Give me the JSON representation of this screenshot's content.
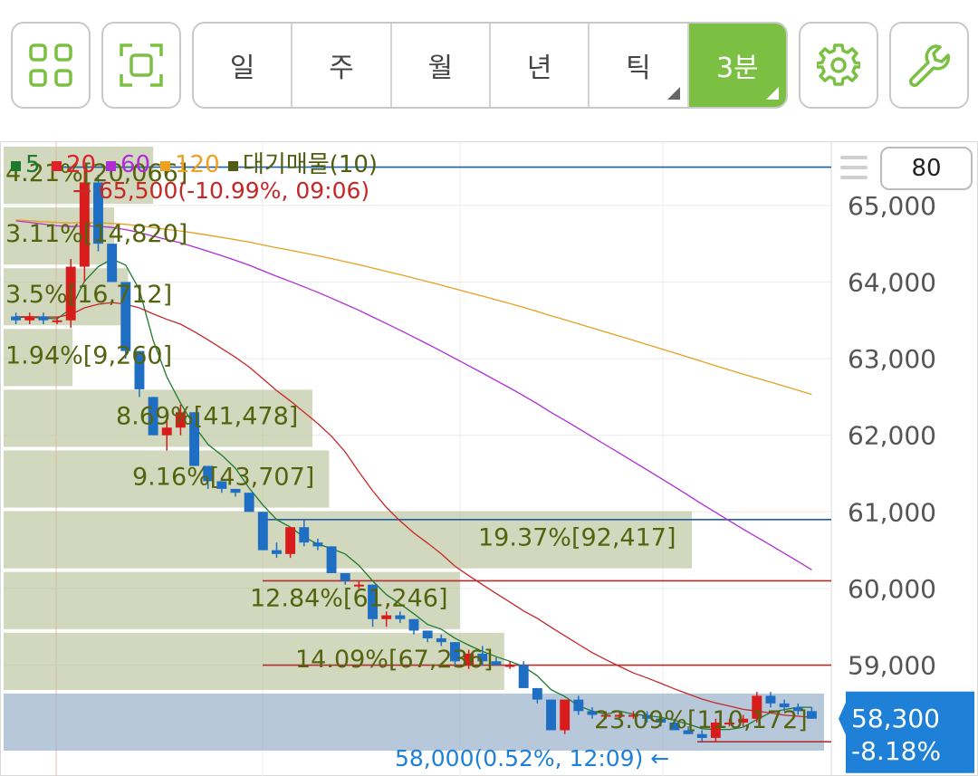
{
  "toolbar": {
    "grid_icon": "grid-icon",
    "fullscreen_icon": "fullscreen-icon",
    "periods": [
      "일",
      "주",
      "월",
      "년",
      "틱",
      "3분"
    ],
    "active_period": "3분",
    "settings_icon": "gear-icon",
    "tools_icon": "wrench-icon"
  },
  "count_input": {
    "value": "80"
  },
  "colors": {
    "accent": "#7bc043",
    "up": "#d81b1b",
    "down": "#1e6fc4",
    "ma5": "#1c7a2e",
    "ma20": "#c62828",
    "ma60": "#b02dd6",
    "ma120": "#e6a020",
    "volume_profile": "#5a6b11",
    "current_price_bg": "#1e80d6"
  },
  "chart_data": {
    "type": "candlestick",
    "legend": [
      {
        "label": "5",
        "color": "#1c7a2e"
      },
      {
        "label": "20",
        "color": "#e0202a"
      },
      {
        "label": "60",
        "color": "#b02dd6"
      },
      {
        "label": "120",
        "color": "#f0a020"
      },
      {
        "label": "대기매물(10)",
        "color": "#4f5e0e"
      }
    ],
    "y_ticks": [
      "65,000",
      "64,000",
      "63,000",
      "62,000",
      "61,000",
      "60,000",
      "59,000"
    ],
    "y_tick_values": [
      65000,
      64000,
      63000,
      62000,
      61000,
      60000,
      59000
    ],
    "ylim": [
      57860,
      65790
    ],
    "high_annotation": "65,500(-10.99%, 09:06)",
    "low_annotation": "58,000(0.52%, 12:09)",
    "current_price": "58,300",
    "current_change": "-8.18%",
    "volume_profile": [
      {
        "label": "4.21%[20,066]",
        "pct": 4.21
      },
      {
        "label": "3.11%[14,820]",
        "pct": 3.11
      },
      {
        "label": "3.5%[16,712]",
        "pct": 3.5
      },
      {
        "label": "1.94%[9,260]",
        "pct": 1.94
      },
      {
        "label": "8.69%[41,478]",
        "pct": 8.69
      },
      {
        "label": "9.16%[43,707]",
        "pct": 9.16
      },
      {
        "label": "19.37%[92,417]",
        "pct": 19.37
      },
      {
        "label": "12.84%[61,246]",
        "pct": 12.84
      },
      {
        "label": "14.09%[67,236]",
        "pct": 14.09
      },
      {
        "label": "23.09%[110,172]",
        "pct": 23.09
      }
    ],
    "horizontal_lines": [
      {
        "price": 65500,
        "color": "#1f5fa8"
      },
      {
        "price": 60900,
        "color": "#1f5fa8"
      },
      {
        "price": 60100,
        "color": "#b03030"
      },
      {
        "price": 59000,
        "color": "#b03030"
      },
      {
        "price": 58000,
        "color": "#b03030"
      }
    ],
    "candles": [
      [
        63550,
        63600,
        63450,
        63500
      ],
      [
        63500,
        63600,
        63450,
        63550
      ],
      [
        63550,
        63600,
        63450,
        63500
      ],
      [
        63500,
        63550,
        63450,
        63500
      ],
      [
        63500,
        64300,
        63400,
        64200
      ],
      [
        64200,
        65500,
        64000,
        65300
      ],
      [
        65300,
        65400,
        64400,
        64500
      ],
      [
        64500,
        64500,
        64000,
        64000
      ],
      [
        64000,
        64000,
        63000,
        63100
      ],
      [
        63100,
        63100,
        62500,
        62600
      ],
      [
        62500,
        62500,
        62000,
        62000
      ],
      [
        62000,
        62200,
        61800,
        62100
      ],
      [
        62100,
        62400,
        62000,
        62300
      ],
      [
        62300,
        62300,
        61600,
        61600
      ],
      [
        61600,
        61600,
        61300,
        61400
      ],
      [
        61400,
        61400,
        61250,
        61300
      ],
      [
        61300,
        61300,
        61200,
        61250
      ],
      [
        61250,
        61250,
        61000,
        61000
      ],
      [
        61000,
        61000,
        60500,
        60500
      ],
      [
        60500,
        60600,
        60400,
        60450
      ],
      [
        60450,
        60800,
        60400,
        60800
      ],
      [
        60800,
        60900,
        60550,
        60600
      ],
      [
        60600,
        60650,
        60500,
        60550
      ],
      [
        60550,
        60550,
        60200,
        60200
      ],
      [
        60200,
        60200,
        60050,
        60100
      ],
      [
        60050,
        60100,
        60000,
        60050
      ],
      [
        60050,
        60050,
        59500,
        59600
      ],
      [
        59600,
        59700,
        59500,
        59650
      ],
      [
        59650,
        59700,
        59550,
        59600
      ],
      [
        59600,
        59600,
        59400,
        59450
      ],
      [
        59450,
        59450,
        59300,
        59350
      ],
      [
        59350,
        59400,
        59250,
        59300
      ],
      [
        59300,
        59300,
        59000,
        59050
      ],
      [
        59000,
        59200,
        58950,
        59150
      ],
      [
        59150,
        59250,
        59000,
        59050
      ],
      [
        59050,
        59100,
        59000,
        59000
      ],
      [
        59000,
        59050,
        58950,
        59000
      ],
      [
        59000,
        59050,
        58700,
        58700
      ],
      [
        58700,
        58700,
        58500,
        58550
      ],
      [
        58550,
        58550,
        58150,
        58150
      ],
      [
        58150,
        58550,
        58100,
        58550
      ],
      [
        58550,
        58600,
        58350,
        58400
      ],
      [
        58400,
        58450,
        58300,
        58350
      ],
      [
        58350,
        58400,
        58300,
        58350
      ],
      [
        58350,
        58400,
        58300,
        58350
      ],
      [
        58350,
        58400,
        58300,
        58350
      ],
      [
        58350,
        58400,
        58250,
        58300
      ],
      [
        58300,
        58350,
        58200,
        58250
      ],
      [
        58250,
        58300,
        58150,
        58150
      ],
      [
        58150,
        58200,
        58100,
        58100
      ],
      [
        58100,
        58150,
        58000,
        58050
      ],
      [
        58050,
        58300,
        58000,
        58250
      ],
      [
        58250,
        58300,
        58200,
        58250
      ],
      [
        58250,
        58350,
        58200,
        58300
      ],
      [
        58300,
        58650,
        58250,
        58600
      ],
      [
        58600,
        58650,
        58450,
        58500
      ],
      [
        58500,
        58550,
        58400,
        58450
      ],
      [
        58450,
        58500,
        58350,
        58400
      ],
      [
        58400,
        58450,
        58300,
        58300
      ]
    ],
    "ma": [
      {
        "period": 5,
        "color": "#1c7a2e"
      },
      {
        "period": 20,
        "color": "#c62828"
      },
      {
        "period": 60,
        "color": "#b02dd6"
      },
      {
        "period": 120,
        "color": "#e6a020"
      }
    ]
  }
}
